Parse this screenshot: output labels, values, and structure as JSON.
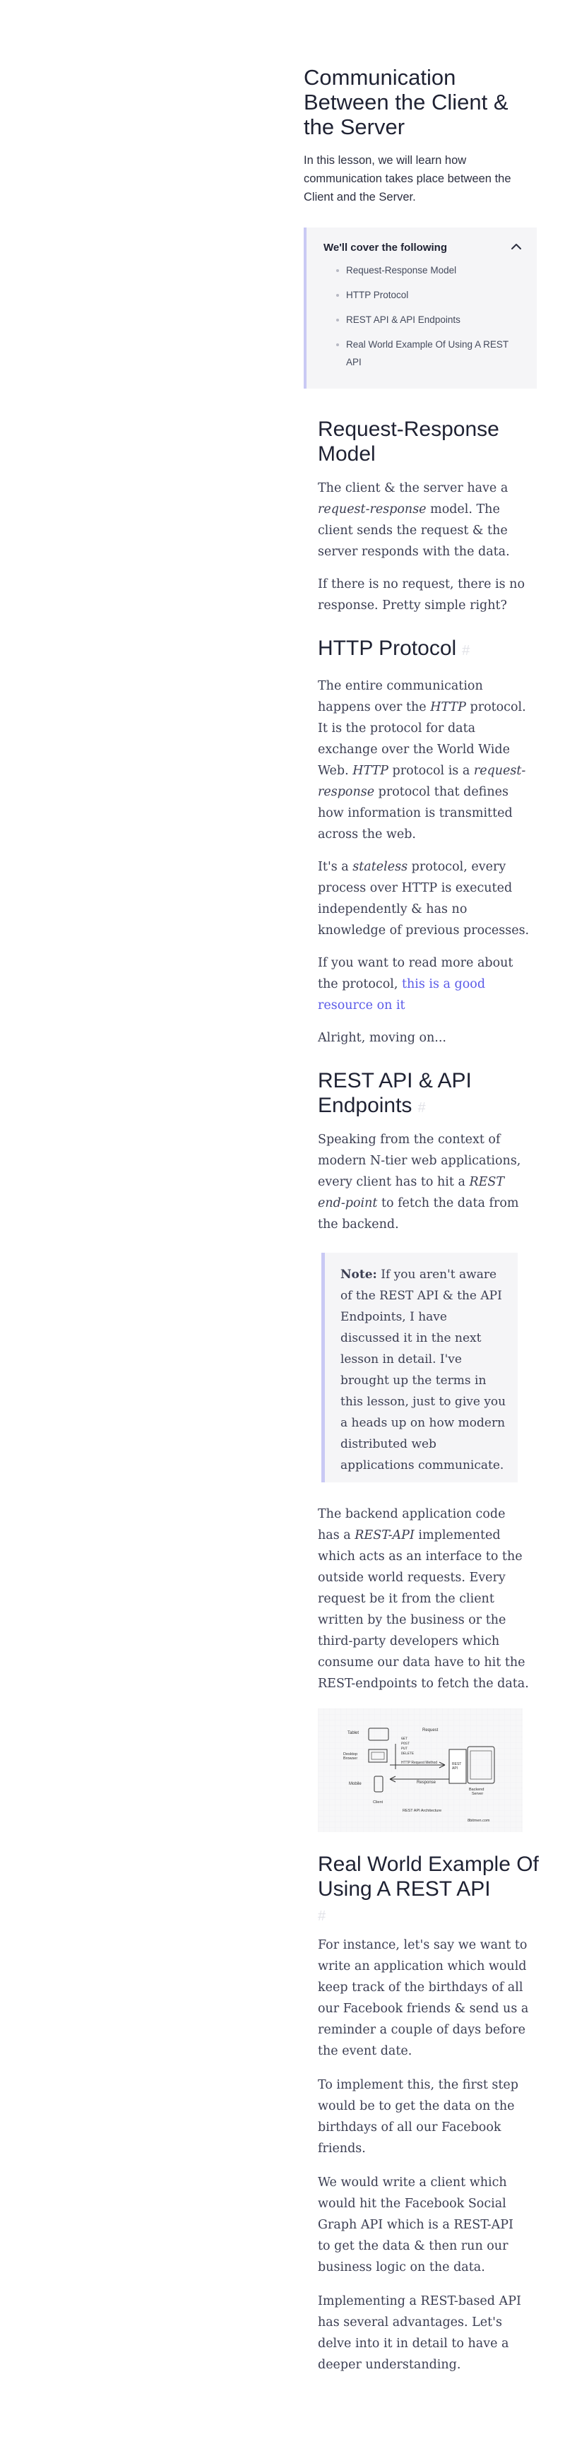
{
  "title": "Communication Between the Client & the Server",
  "intro": "In this lesson, we will learn how communication takes place between the Client and the Server.",
  "toc": {
    "heading": "We'll cover the following",
    "items": [
      "Request-Response Model",
      "HTTP Protocol",
      "REST API & API Endpoints",
      "Real World Example Of Using A REST API"
    ]
  },
  "sections": {
    "s1": {
      "heading": "Request-Response Model",
      "p1": {
        "a": "The client & the server have a ",
        "em": "request-response",
        "b": " model. The client sends the request & the server responds with the data."
      },
      "p2": "If there is no request, there is no response. Pretty simple right?"
    },
    "s2": {
      "heading": "HTTP Protocol",
      "p1": {
        "a": "The entire communication happens over the ",
        "em1": "HTTP",
        "b": " protocol. It is the protocol for data exchange over the World Wide Web. ",
        "em2": "HTTP",
        "c": " protocol is a ",
        "em3": "request-response",
        "d": " protocol that defines how information is transmitted across the web."
      },
      "p2": {
        "a": "It's a ",
        "em": "stateless",
        "b": " protocol, every process over HTTP is executed independently & has no knowledge of previous processes."
      },
      "p3": {
        "a": "If you want to read more about the protocol, ",
        "link": "this is a good resource on it"
      },
      "p4": "Alright, moving on..."
    },
    "s3": {
      "heading": "REST API & API Endpoints",
      "p1": {
        "a": "Speaking from the context of modern N-tier web applications, every client has to hit a ",
        "em": "REST end-point",
        "b": " to fetch the data from the backend."
      },
      "note": {
        "label": "Note:",
        "text": " If you aren't aware of the REST API & the API Endpoints, I have discussed it in the next lesson in detail. I've brought up the terms in this lesson, just to give you a heads up on how modern distributed web applications communicate."
      },
      "p2": {
        "a": "The backend application code has a ",
        "em": "REST-API",
        "b": " implemented which acts as an interface to the outside world requests. Every request be it from the client written by the business or the third-party developers which consume our data have to hit the REST-endpoints to fetch the data."
      },
      "diagram": {
        "labels": {
          "tablet": "Tablet",
          "desktop": "Desktop Browser",
          "mobile": "Mobile",
          "client": "Client",
          "request": "Request",
          "verbs": "GET\nPOST\nPUT\nDELETE",
          "http": "HTTP Request Method",
          "response": "Response",
          "rest_api": "REST API",
          "backend": "Backend Server",
          "architecture": "REST API Architecture",
          "brand": "8bitmen.com"
        }
      }
    },
    "s4": {
      "heading": "Real World Example Of Using A REST API",
      "p1": "For instance, let's say we want to write an application which would keep track of the birthdays of all our Facebook friends & send us a reminder a couple of days before the event date.",
      "p2": "To implement this, the first step would be to get the data on the birthdays of all our Facebook friends.",
      "p3": "We would write a client which would hit the Facebook Social Graph API which is a REST-API to get the data & then run our business logic on the data.",
      "p4": "Implementing a REST-based API has several advantages. Let's delve into it in detail to have a deeper understanding."
    }
  },
  "anchor_symbol": "#",
  "colors": {
    "accent": "#c9c9f4",
    "link": "#5b5be8"
  }
}
